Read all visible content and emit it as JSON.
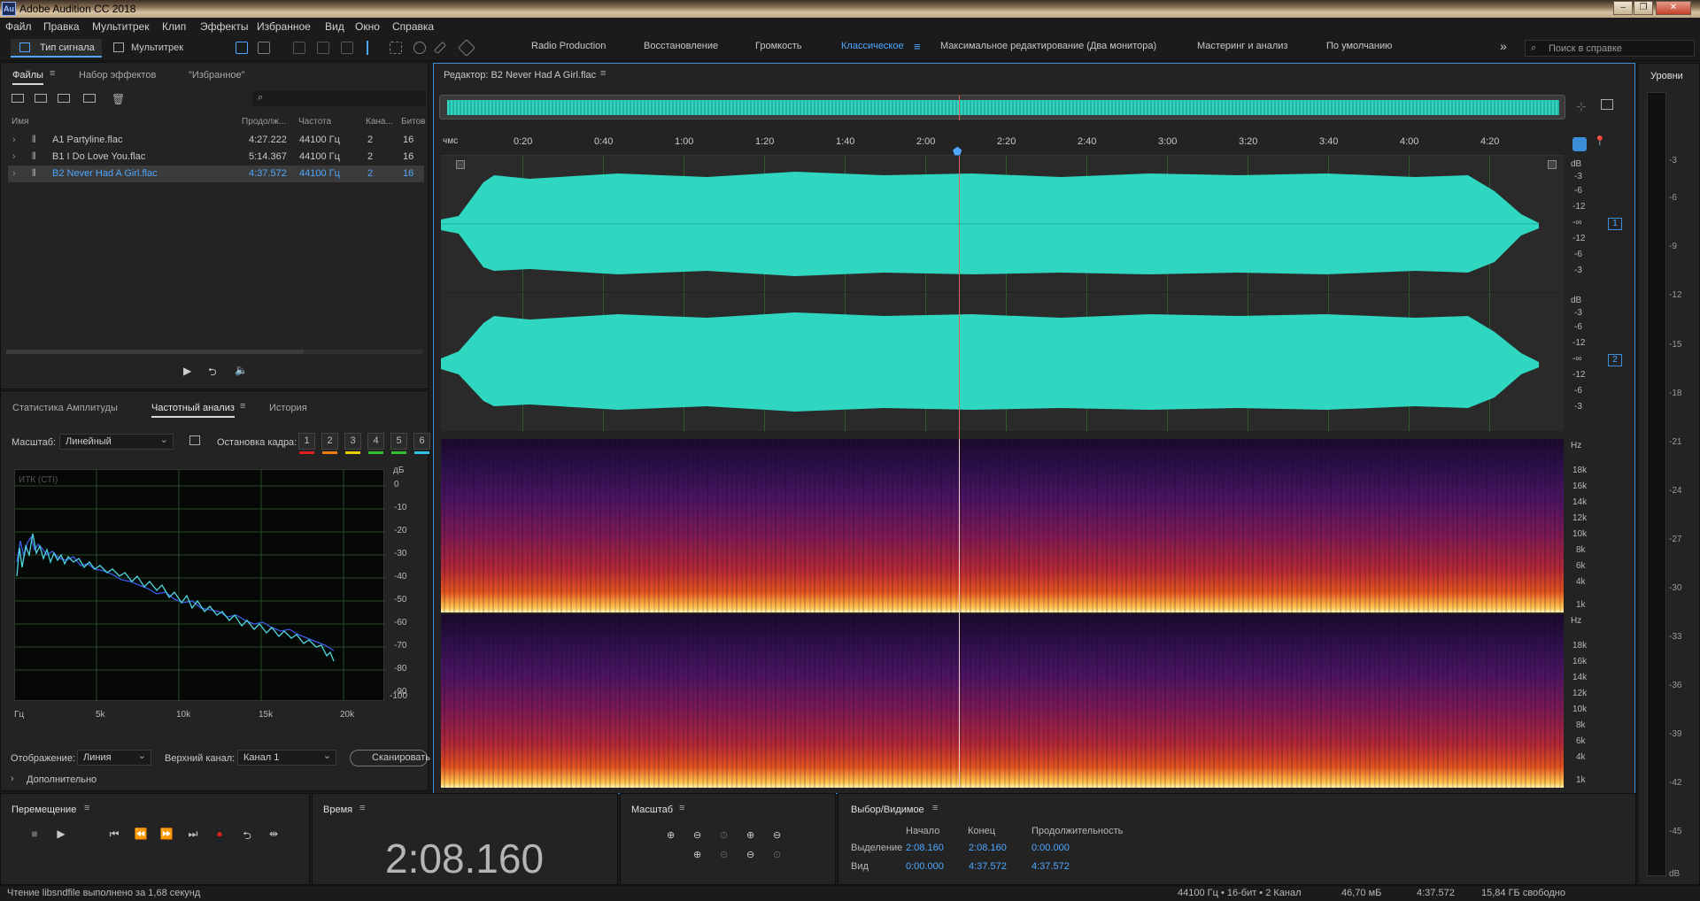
{
  "window": {
    "title": "Adobe Audition CC 2018",
    "app_icon": "Au"
  },
  "menu": [
    "Файл",
    "Правка",
    "Мультитрек",
    "Клип",
    "Эффекты",
    "Избранное",
    "Вид",
    "Окно",
    "Справка"
  ],
  "toolbar": {
    "waveform_label": "Тип сигнала",
    "multitrack_label": "Мультитрек",
    "workspaces": [
      "Radio Production",
      "Восстановление",
      "Громкость",
      "Классическое",
      "Максимальное редактирование (Два монитора)",
      "Мастеринг и анализ",
      "По умолчанию"
    ],
    "active_workspace": "Классическое",
    "search_placeholder": "Поиск в справке"
  },
  "files_panel": {
    "tabs": [
      "Файлы",
      "Набор эффектов",
      "\"Избранное\""
    ],
    "search_placeholder": "",
    "columns": [
      "Имя",
      "Продолж...",
      "Частота",
      "Кана...",
      "Битов"
    ],
    "rows": [
      {
        "name": "A1 Partyline.flac",
        "duration": "4:27.222",
        "rate": "44100 Гц",
        "channels": "2",
        "bits": "16"
      },
      {
        "name": "B1 I Do Love You.flac",
        "duration": "5:14.367",
        "rate": "44100 Гц",
        "channels": "2",
        "bits": "16"
      },
      {
        "name": "B2 Never Had A Girl.flac",
        "duration": "4:37.572",
        "rate": "44100 Гц",
        "channels": "2",
        "bits": "16"
      }
    ],
    "selected_index": 2
  },
  "analysis_panel": {
    "tabs": [
      "Статистика Амплитуды",
      "Частотный анализ",
      "История"
    ],
    "scale_label": "Масштаб:",
    "scale_value": "Линейный",
    "freeze_label": "Остановка кадра:",
    "freeze_buttons": [
      "1",
      "2",
      "3",
      "4",
      "5",
      "6"
    ],
    "freeze_colors": [
      "#e02020",
      "#f07a10",
      "#e8d000",
      "#30c030",
      "#30c0e0",
      "#30c0e0"
    ],
    "graph_label": "ИТК (СТI)",
    "db_unit": "дБ",
    "db_ticks": [
      "0",
      "-10",
      "-20",
      "-30",
      "-40",
      "-50",
      "-60",
      "-70",
      "-80",
      "-90",
      "-100"
    ],
    "hz_ticks": [
      "Гц",
      "5k",
      "10k",
      "15k",
      "20k"
    ],
    "display_label": "Отображение:",
    "display_value": "Линия",
    "channel_label": "Верхний канал:",
    "channel_value": "Канал 1",
    "scan_button": "Сканировать",
    "advanced_label": "Дополнительно"
  },
  "editor": {
    "title": "Редактор: B2 Never Had A Girl.flac",
    "time_unit": "чмс",
    "ruler_ticks": [
      "0:20",
      "0:40",
      "1:00",
      "1:20",
      "1:40",
      "2:00",
      "2:20",
      "2:40",
      "3:00",
      "3:20",
      "3:40",
      "4:00",
      "4:20"
    ],
    "db_scale": [
      "dB",
      "-3",
      "-6",
      "-12",
      "-∞",
      "-12",
      "-6",
      "-3"
    ],
    "channel_numbers": [
      "1",
      "2"
    ],
    "hz_scale": [
      "Hz",
      "18k",
      "16k",
      "14k",
      "12k",
      "10k",
      "8k",
      "6k",
      "4k",
      "1k"
    ],
    "playhead_fraction": 0.4613,
    "waveform_color": "#2fd6c0"
  },
  "levels_panel": {
    "title": "Уровни",
    "ticks": [
      "-3",
      "-6",
      "-9",
      "-12",
      "-15",
      "-18",
      "-21",
      "-24",
      "-27",
      "-30",
      "-33",
      "-36",
      "-39",
      "-42",
      "-45",
      "dB"
    ]
  },
  "transport": {
    "title": "Перемещение",
    "buttons": [
      "stop",
      "play",
      "go-start",
      "rewind",
      "fast-forward",
      "go-end",
      "record",
      "loop",
      "skip"
    ]
  },
  "time_panel": {
    "title": "Время",
    "value": "2:08.160"
  },
  "zoom_panel": {
    "title": "Масштаб"
  },
  "selection_panel": {
    "title": "Выбор/Видимое",
    "col_start": "Начало",
    "col_end": "Конец",
    "col_duration": "Продолжительность",
    "row_selection": {
      "label": "Выделение",
      "start": "2:08.160",
      "end": "2:08.160",
      "duration": "0:00.000"
    },
    "row_view": {
      "label": "Вид",
      "start": "0:00.000",
      "end": "4:37.572",
      "duration": "4:37.572"
    }
  },
  "status": {
    "message": "Чтение libsndfile выполнено за 1,68 секунд",
    "format": "44100 Гц • 16-бит • 2 Канал",
    "size": "46,70 мБ",
    "duration": "4:37.572",
    "free": "15,84 ГБ свободно"
  }
}
